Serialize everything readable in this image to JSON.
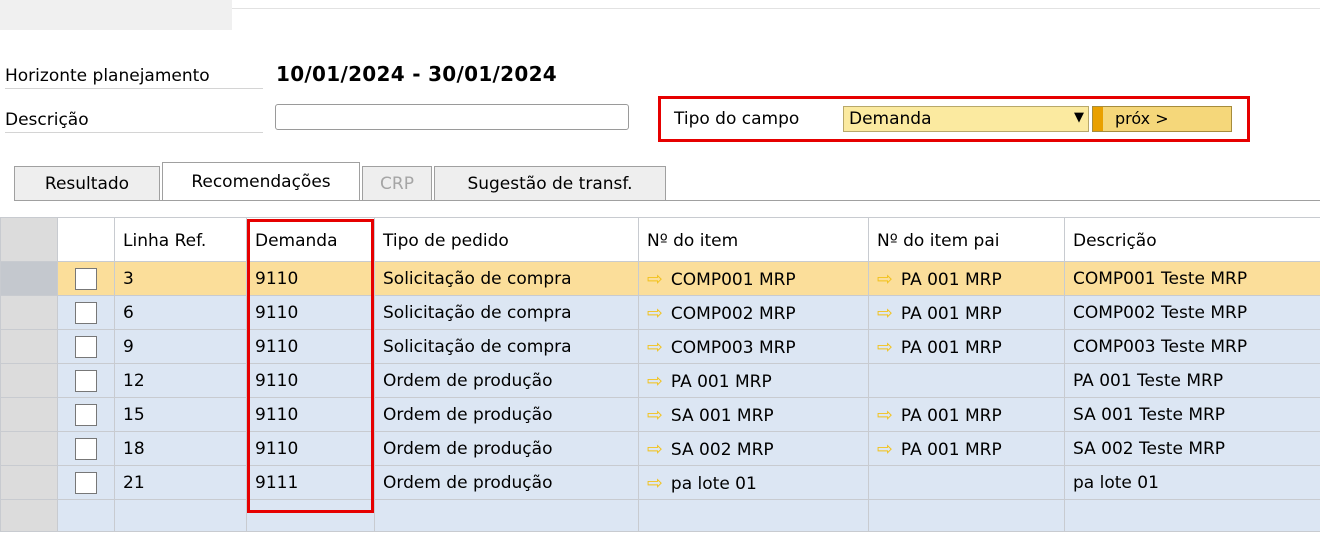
{
  "header": {
    "horizonte_label": "Horizonte planejamento",
    "horizonte_value": "10/01/2024 - 30/01/2024",
    "descricao_label": "Descrição",
    "descricao_value": ""
  },
  "field_type": {
    "label": "Tipo do campo",
    "selected": "Demanda",
    "next_label": "próx >"
  },
  "colors": {
    "highlight_border": "#e60000",
    "selected_row": "#fbde9a",
    "row_bg": "#dce6f3"
  },
  "tabs": [
    {
      "label": "Resultado",
      "active": false,
      "disabled": false
    },
    {
      "label": "Recomendações",
      "active": true,
      "disabled": false
    },
    {
      "label": "CRP",
      "active": false,
      "disabled": true
    },
    {
      "label": "Sugestão de transf.",
      "active": false,
      "disabled": false
    }
  ],
  "table": {
    "columns": [
      "Linha Ref.",
      "Demanda",
      "Tipo de pedido",
      "Nº do item",
      "Nº do item pai",
      "Descrição"
    ],
    "rows": [
      {
        "linha": "3",
        "demanda": "9110",
        "tipo": "Solicitação de compra",
        "item": "COMP001 MRP",
        "pai": "PA 001 MRP",
        "descricao": "COMP001 Teste MRP",
        "selected": true
      },
      {
        "linha": "6",
        "demanda": "9110",
        "tipo": "Solicitação de compra",
        "item": "COMP002 MRP",
        "pai": "PA 001 MRP",
        "descricao": "COMP002 Teste MRP"
      },
      {
        "linha": "9",
        "demanda": "9110",
        "tipo": "Solicitação de compra",
        "item": "COMP003 MRP",
        "pai": "PA 001 MRP",
        "descricao": "COMP003 Teste MRP"
      },
      {
        "linha": "12",
        "demanda": "9110",
        "tipo": "Ordem de produção",
        "item": "PA 001 MRP",
        "pai": "",
        "descricao": "PA 001 Teste MRP"
      },
      {
        "linha": "15",
        "demanda": "9110",
        "tipo": "Ordem de produção",
        "item": "SA 001 MRP",
        "pai": "PA 001 MRP",
        "descricao": "SA 001 Teste MRP"
      },
      {
        "linha": "18",
        "demanda": "9110",
        "tipo": "Ordem de produção",
        "item": "SA 002 MRP",
        "pai": "PA 001 MRP",
        "descricao": "SA 002 Teste MRP"
      },
      {
        "linha": "21",
        "demanda": "9111",
        "tipo": "Ordem de produção",
        "item": "pa lote 01",
        "pai": "",
        "descricao": "pa lote 01"
      }
    ]
  },
  "icons": {
    "link_arrow": "link-arrow-icon",
    "dropdown": "chevron-down-icon"
  }
}
